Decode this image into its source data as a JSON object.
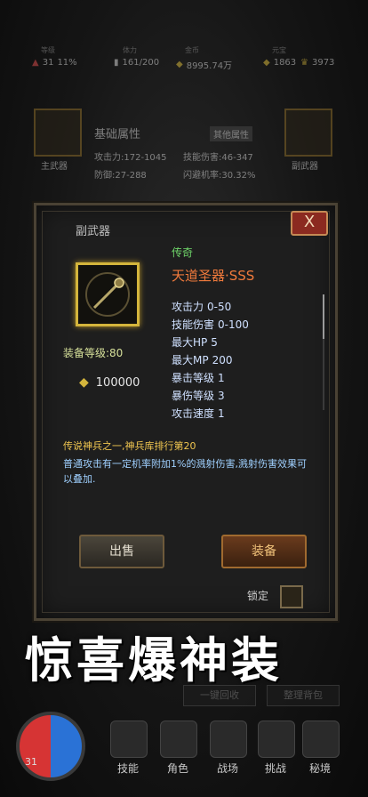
{
  "top_stats": [
    {
      "caption": "等级",
      "value": "31",
      "extra": "11%",
      "color": "#d64b4b"
    },
    {
      "caption": "体力",
      "value": "161/200",
      "color": "#cfcfcf"
    },
    {
      "caption": "金币",
      "value": "8995.74万",
      "color": "#cfcfcf"
    },
    {
      "caption": "元宝",
      "value": "1863",
      "color": "#cfcfcf"
    },
    {
      "caption": "",
      "value": "3973",
      "color": "#cfcfcf"
    }
  ],
  "background_panel": {
    "title": "基础属性",
    "tag": "其他属性",
    "main_weapon": "主武器",
    "sub_weapon": "副武器",
    "attack": "攻击力:172-1045",
    "skill_damage": "技能伤害:46-347",
    "defense": "防御:27-288",
    "dodge": "闪避机率:30.32%"
  },
  "modal": {
    "title": "副武器",
    "close_label": "X",
    "rarity": "传奇",
    "item_name": "天道圣器·SSS",
    "equip_level": "装备等级:80",
    "price": "100000",
    "attributes": [
      {
        "k": "攻击力",
        "v": "0-50"
      },
      {
        "k": "技能伤害",
        "v": "0-100"
      },
      {
        "k": "最大HP",
        "v": "5"
      },
      {
        "k": "最大MP",
        "v": "200"
      },
      {
        "k": "暴击等级",
        "v": "1"
      },
      {
        "k": "暴伤等级",
        "v": "3"
      },
      {
        "k": "攻击速度",
        "v": "1"
      }
    ],
    "legend": "传说神兵之一,神兵库排行第20",
    "description": "普通攻击有一定机率附加1%的溅射伤害,溅射伤害效果可以叠加.",
    "sell_label": "出售",
    "equip_label": "装备",
    "lock_label": "锁定"
  },
  "banner": {
    "text": "惊喜爆神装"
  },
  "recycle_buttons": [
    "一键回收",
    "整理背包"
  ],
  "bottom_nav": [
    {
      "label": "技能"
    },
    {
      "label": "角色"
    },
    {
      "label": "战场"
    },
    {
      "label": "挑战"
    },
    {
      "label": "秘境"
    }
  ],
  "player_level": "31",
  "colors": {
    "legendary_green": "#70d76b",
    "item_name_orange": "#f07a3c",
    "gold": "#d4b53c"
  }
}
